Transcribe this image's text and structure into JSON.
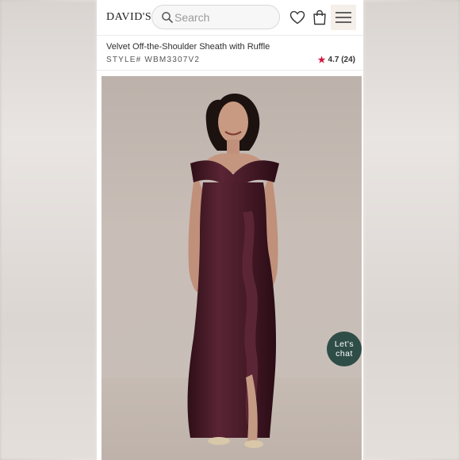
{
  "header": {
    "logo": "DAVID'S",
    "search_placeholder": "Search"
  },
  "product": {
    "title": "Velvet Off-the-Shoulder Sheath with Ruffle",
    "style": "STYLE# WBM3307V2",
    "rating": "4.7 (24)"
  },
  "chat": {
    "line1": "Let's",
    "line2": "chat"
  },
  "colors": {
    "accent_star": "#d4133c",
    "chat_bg": "#2f4d47",
    "menu_bg": "#f4efe9",
    "dress": "#4a1c2a"
  },
  "icons": [
    "search-icon",
    "heart-icon",
    "bag-icon",
    "menu-icon",
    "star-icon"
  ]
}
